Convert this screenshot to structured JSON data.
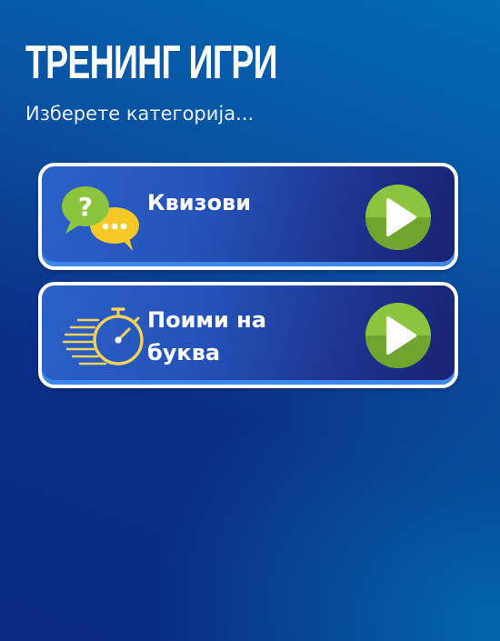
{
  "header": {
    "title": "ТРЕНИНГ ИГРИ",
    "subtitle": "Изберете категорија..."
  },
  "categories": [
    {
      "label": "Квизови",
      "icon": "chat-bubbles-question-icon",
      "action_icon": "play-icon"
    },
    {
      "label": "Поими на буква",
      "icon": "stopwatch-icon",
      "action_icon": "play-icon"
    }
  ],
  "colors": {
    "background_top": "#006cb3",
    "background_bottom": "#0a2a82",
    "card_border": "#ffffff",
    "play_button": "#8bc53f",
    "question_bubble": "#8bc53f",
    "dots_bubble": "#f7c928",
    "stopwatch": "#f4d25a"
  }
}
